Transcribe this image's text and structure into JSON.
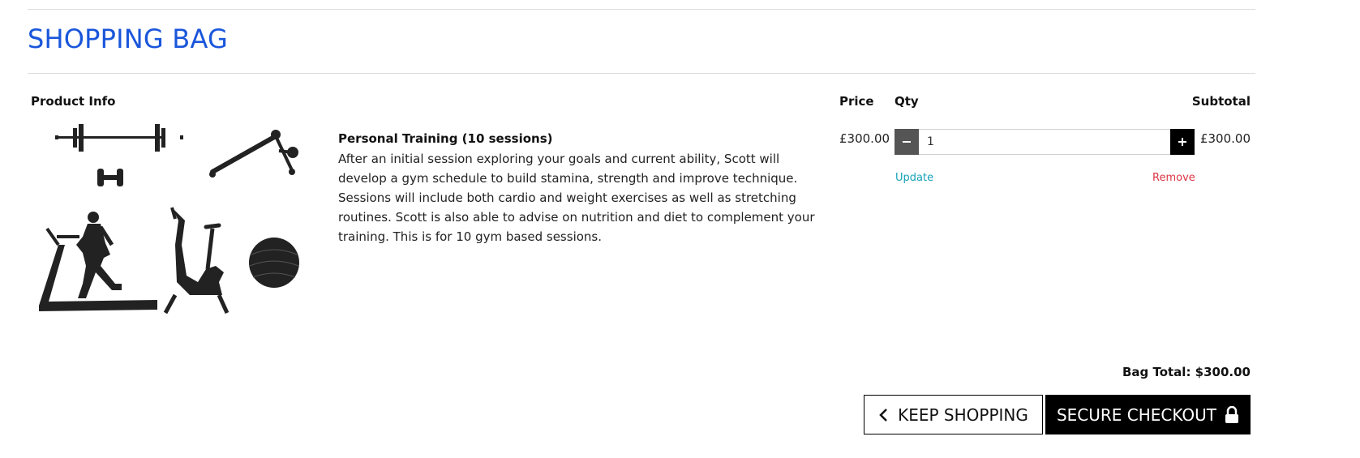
{
  "page": {
    "title": "SHOPPING BAG"
  },
  "table": {
    "headers": {
      "product_info": "Product Info",
      "price": "Price",
      "qty": "Qty",
      "subtotal": "Subtotal"
    }
  },
  "items": [
    {
      "name": "Personal Training (10 sessions)",
      "description": "After an initial session exploring your goals and current ability, Scott will develop a gym schedule to build stamina, strength and improve technique. Sessions will include both cardio and weight exercises as well as stretching routines. Scott is also able to advise on nutrition and diet to complement your training. This is for 10 gym based sessions.",
      "price": "£300.00",
      "qty": "1",
      "subtotal": "£300.00",
      "update_label": "Update",
      "remove_label": "Remove",
      "image_icon": "gym-equipment-icon"
    }
  ],
  "summary": {
    "bag_total": "Bag Total: $300.00"
  },
  "actions": {
    "keep_shopping": "KEEP SHOPPING",
    "secure_checkout": "SECURE CHECKOUT"
  },
  "colors": {
    "title": "#1a56db",
    "update_link": "#17a2b8",
    "remove_link": "#dc3545",
    "checkout_bg": "#000000"
  }
}
